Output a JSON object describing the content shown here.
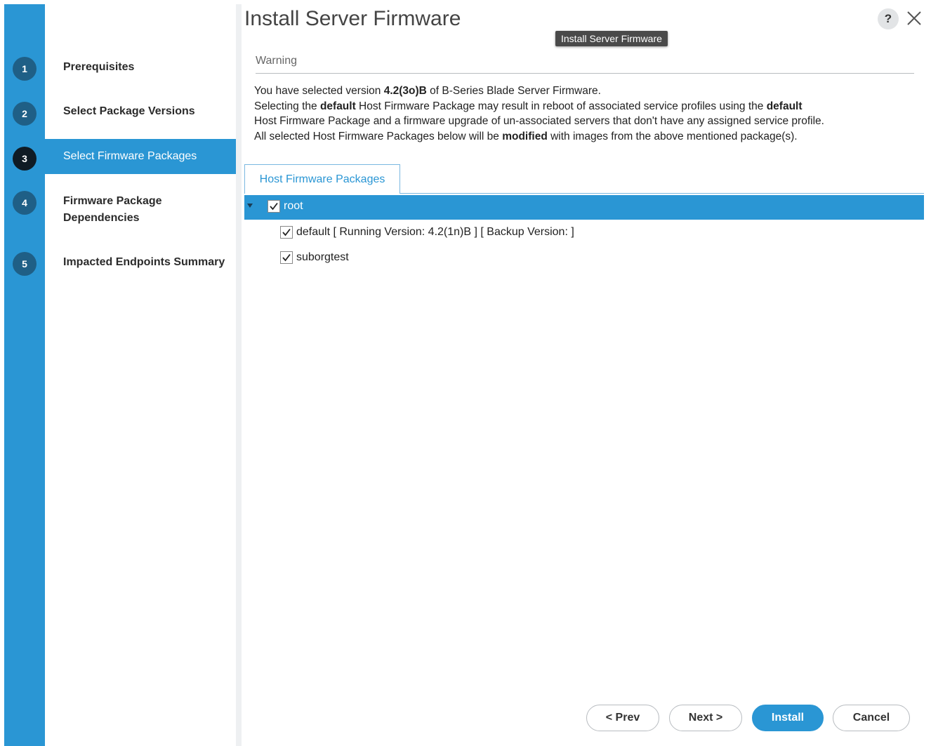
{
  "dialog": {
    "title": "Install Server Firmware",
    "tooltip": "Install Server Firmware",
    "help_glyph": "?"
  },
  "steps": [
    {
      "number": "1",
      "label": "Prerequisites"
    },
    {
      "number": "2",
      "label": "Select Package Versions"
    },
    {
      "number": "3",
      "label": "Select Firmware Packages",
      "active": true
    },
    {
      "number": "4",
      "label": "Firmware Package Dependencies"
    },
    {
      "number": "5",
      "label": "Impacted Endpoints Summary"
    }
  ],
  "warning": {
    "heading": "Warning",
    "l1a": "You have selected version ",
    "l1b": "4.2(3o)B",
    "l1c": " of B-Series Blade Server Firmware.",
    "l2a": "Selecting the ",
    "l2b": "default",
    "l2c": " Host Firmware Package may result in reboot of associated service profiles using the ",
    "l2d": "default",
    "l3": "Host Firmware Package and a firmware upgrade of un-associated servers that don't have any assigned service profile.",
    "l4a": "All selected Host Firmware Packages below will be ",
    "l4b": "modified",
    "l4c": " with images from the above mentioned package(s)."
  },
  "tabs": {
    "host_firmware": "Host Firmware Packages"
  },
  "tree": {
    "root": {
      "label": "root",
      "checked": true
    },
    "children": [
      {
        "label": "default [ Running Version: 4.2(1n)B ] [ Backup Version: ]",
        "checked": true
      },
      {
        "label": "suborgtest",
        "checked": true
      }
    ]
  },
  "buttons": {
    "prev": "< Prev",
    "next": "Next >",
    "install": "Install",
    "cancel": "Cancel"
  },
  "colors": {
    "accent": "#2a96d4",
    "active_step_badge": "#0f1b24",
    "step_badge": "#1f5f86"
  }
}
